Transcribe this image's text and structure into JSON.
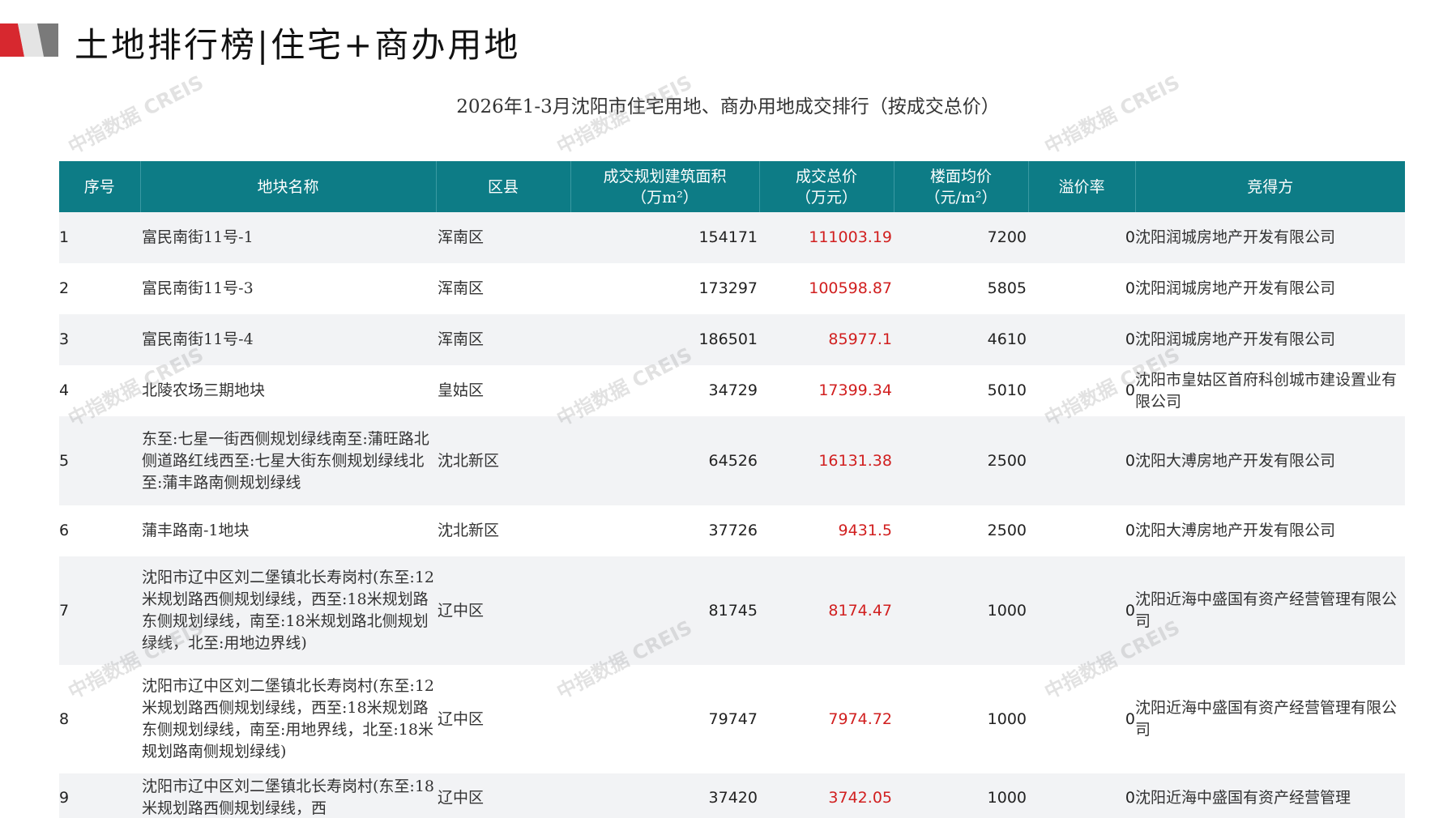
{
  "header": {
    "title": "土地排行榜|住宅+商办用地",
    "accent_color": "#d7282f"
  },
  "table_title": "2026年1-3月沈阳市住宅用地、商办用地成交排行（按成交总价）",
  "watermark_text": "中指数据 CREIS",
  "columns": [
    "序号",
    "地块名称",
    "区县",
    "成交规划建筑面积\n（万m²）",
    "成交总价\n（万元）",
    "楼面均价\n（元/m²）",
    "溢价率",
    "竞得方"
  ],
  "rows": [
    {
      "no": "1",
      "name": "富民南街11号-1",
      "district": "浑南区",
      "area": "154171",
      "price": "111003.19",
      "unit_price": "7200",
      "premium": "0",
      "buyer": "沈阳润城房地产开发有限公司"
    },
    {
      "no": "2",
      "name": "富民南街11号-3",
      "district": "浑南区",
      "area": "173297",
      "price": "100598.87",
      "unit_price": "5805",
      "premium": "0",
      "buyer": "沈阳润城房地产开发有限公司"
    },
    {
      "no": "3",
      "name": "富民南街11号-4",
      "district": "浑南区",
      "area": "186501",
      "price": "85977.1",
      "unit_price": "4610",
      "premium": "0",
      "buyer": "沈阳润城房地产开发有限公司"
    },
    {
      "no": "4",
      "name": "北陵农场三期地块",
      "district": "皇姑区",
      "area": "34729",
      "price": "17399.34",
      "unit_price": "5010",
      "premium": "0",
      "buyer": "沈阳市皇姑区首府科创城市建设置业有限公司"
    },
    {
      "no": "5",
      "name": "东至:七星一街西侧规划绿线南至:蒲旺路北侧道路红线西至:七星大街东侧规划绿线北至:蒲丰路南侧规划绿线",
      "district": "沈北新区",
      "area": "64526",
      "price": "16131.38",
      "unit_price": "2500",
      "premium": "0",
      "buyer": "沈阳大溥房地产开发有限公司"
    },
    {
      "no": "6",
      "name": "蒲丰路南-1地块",
      "district": "沈北新区",
      "area": "37726",
      "price": "9431.5",
      "unit_price": "2500",
      "premium": "0",
      "buyer": "沈阳大溥房地产开发有限公司"
    },
    {
      "no": "7",
      "name": "沈阳市辽中区刘二堡镇北长寿岗村(东至:12米规划路西侧规划绿线，西至:18米规划路东侧规划绿线，南至:18米规划路北侧规划绿线，北至:用地边界线)",
      "district": "辽中区",
      "area": "81745",
      "price": "8174.47",
      "unit_price": "1000",
      "premium": "0",
      "buyer": "沈阳近海中盛国有资产经营管理有限公司"
    },
    {
      "no": "8",
      "name": "沈阳市辽中区刘二堡镇北长寿岗村(东至:12米规划路西侧规划绿线，西至:18米规划路东侧规划绿线，南至:用地界线，北至:18米规划路南侧规划绿线)",
      "district": "辽中区",
      "area": "79747",
      "price": "7974.72",
      "unit_price": "1000",
      "premium": "0",
      "buyer": "沈阳近海中盛国有资产经营管理有限公司"
    },
    {
      "no": "9",
      "name": "沈阳市辽中区刘二堡镇北长寿岗村(东至:18米规划路西侧规划绿线，西",
      "district": "辽中区",
      "area": "37420",
      "price": "3742.05",
      "unit_price": "1000",
      "premium": "0",
      "buyer": "沈阳近海中盛国有资产经营管理"
    }
  ]
}
